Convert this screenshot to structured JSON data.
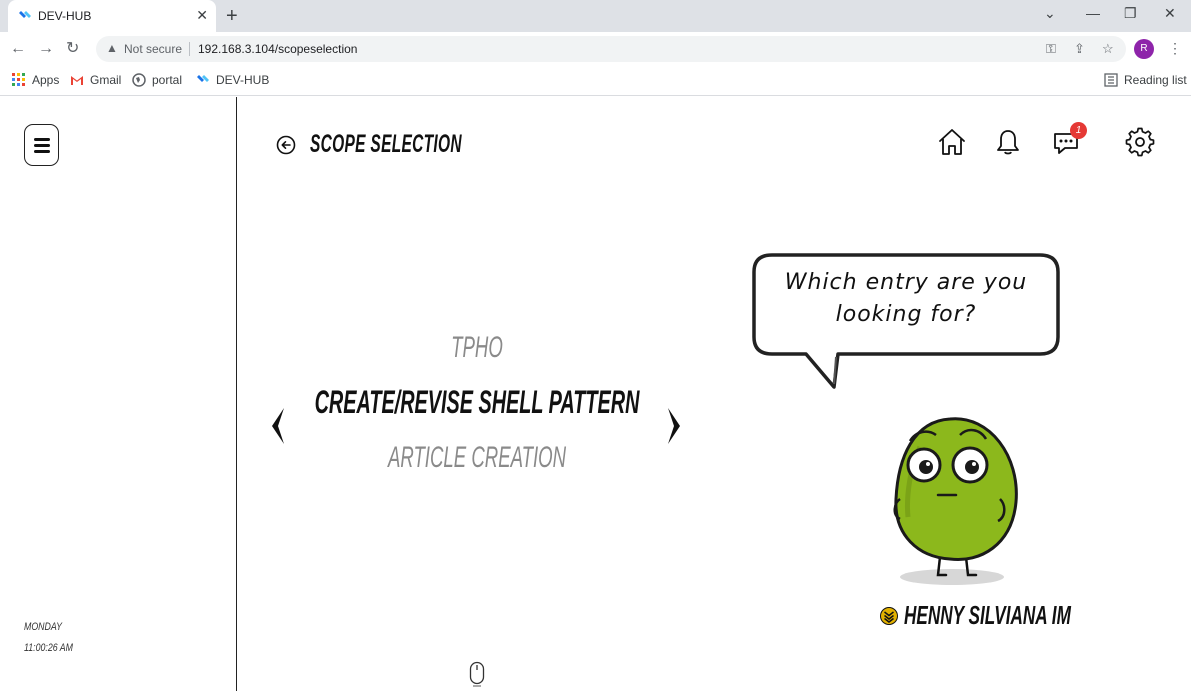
{
  "browser": {
    "tab_title": "DEV-HUB",
    "security_label": "Not secure",
    "url": "192.168.3.104/scopeselection",
    "avatar_letter": "R",
    "bookmarks": [
      "Apps",
      "Gmail",
      "portal",
      "DEV-HUB"
    ],
    "reading_list": "Reading list"
  },
  "page": {
    "title": "SCOPE SELECTION",
    "notification_count": "1",
    "day": "MONDAY",
    "time": "11:00:26 AM"
  },
  "carousel": {
    "prev": "TPHO",
    "current": "CREATE/REVISE SHELL PATTERN",
    "next": "ARTICLE CREATION"
  },
  "assistant": {
    "speech_line1": "Which entry are you",
    "speech_line2": "looking for?"
  },
  "user": {
    "name": "HENNY SILVIANA IM"
  },
  "colors": {
    "accent_badge": "#e53935",
    "mascot_green": "#8cb81c",
    "rank_gold": "#e2b100"
  }
}
